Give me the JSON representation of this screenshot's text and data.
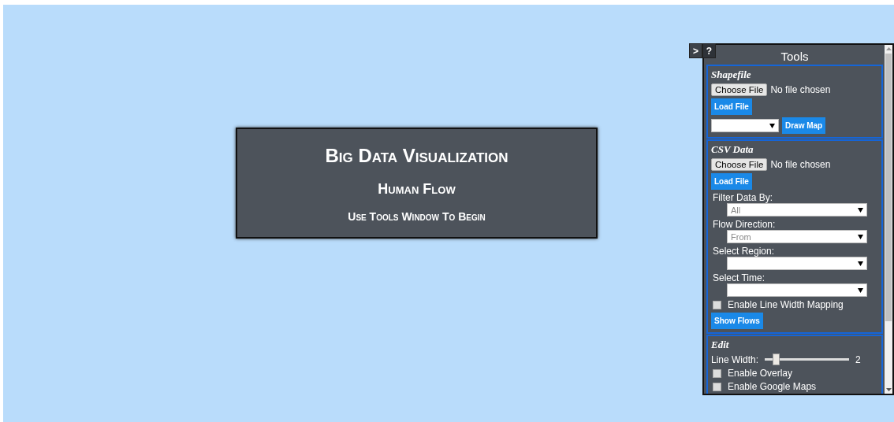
{
  "title_card": {
    "title": "Big Data Visualization",
    "subtitle": "Human Flow",
    "instruction": "Use Tools Window To Begin"
  },
  "tools": {
    "toggle_button": ">",
    "help_button": "?",
    "title": "Tools",
    "sections": [
      {
        "title": "Shapefile",
        "items": [
          {
            "kind": "file",
            "button": "Choose File",
            "status": "No file chosen"
          },
          {
            "kind": "button",
            "label": "Load File"
          },
          {
            "kind": "select_button",
            "button": "Draw Map"
          }
        ]
      },
      {
        "title": "CSV Data",
        "items": [
          {
            "kind": "file",
            "button": "Choose File",
            "status": "No file chosen"
          },
          {
            "kind": "button",
            "label": "Load File"
          },
          {
            "kind": "select",
            "label": "Filter Data By:",
            "value": "All"
          },
          {
            "kind": "select",
            "label": "Flow Direction:",
            "value": "From"
          },
          {
            "kind": "select",
            "label": "Select Region:"
          },
          {
            "kind": "select",
            "label": "Select Time:"
          },
          {
            "kind": "checkbox",
            "label": "Enable Line Width Mapping",
            "checked": false
          },
          {
            "kind": "button",
            "label": "Show Flows"
          }
        ]
      },
      {
        "title": "Edit",
        "items": [
          {
            "kind": "slider",
            "label": "Line Width:",
            "level": 0.14,
            "reading": "2"
          },
          {
            "kind": "checkbox",
            "label": "Enable Overlay",
            "checked": false
          },
          {
            "kind": "checkbox",
            "label": "Enable Google Maps",
            "checked": false
          }
        ]
      }
    ]
  }
}
